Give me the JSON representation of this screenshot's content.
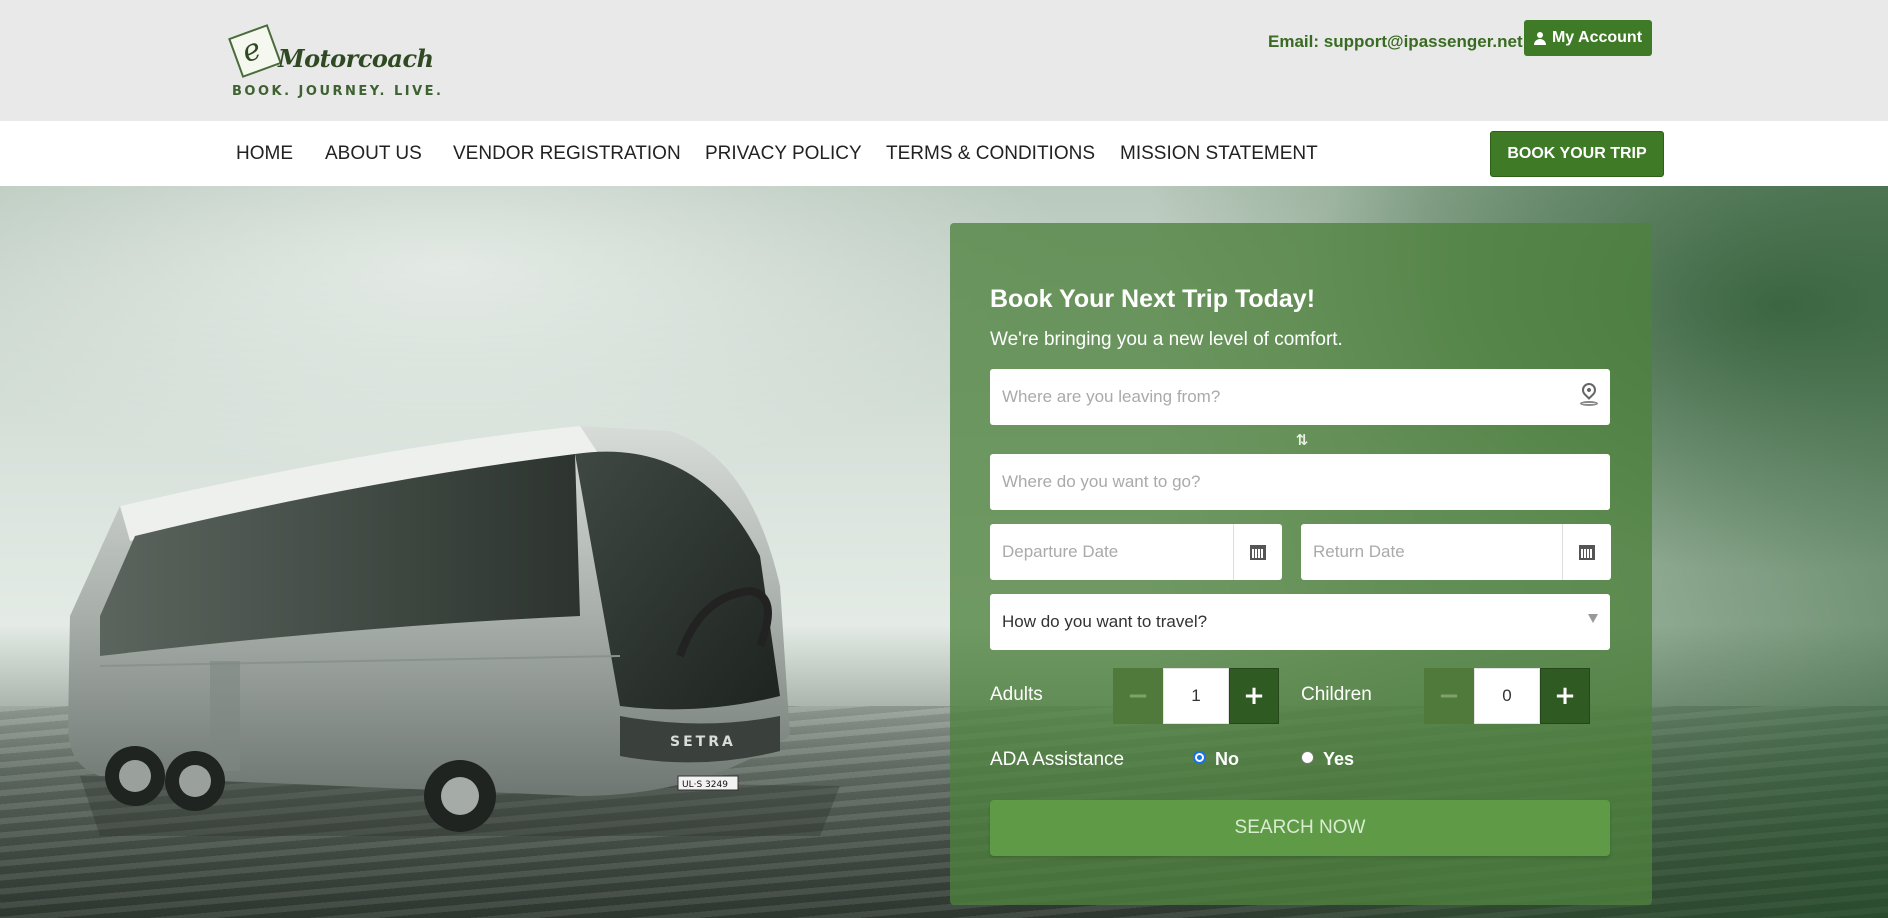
{
  "header": {
    "logo": {
      "wordmark": "Motorcoach",
      "letter": "e",
      "tagline": "BOOK. JOURNEY. LIVE."
    },
    "email_text": "Email: support@ipassenger.net",
    "account_button": "My Account"
  },
  "nav": {
    "items": [
      {
        "label": "HOME"
      },
      {
        "label": "ABOUT US"
      },
      {
        "label": "VENDOR REGISTRATION"
      },
      {
        "label": "PRIVACY POLICY"
      },
      {
        "label": "TERMS & CONDITIONS"
      },
      {
        "label": "MISSION STATEMENT"
      }
    ],
    "cta": "BOOK YOUR TRIP"
  },
  "hero": {
    "bus_plate": "UL·S 3249",
    "bus_brand": "SETRA"
  },
  "booking": {
    "title": "Book Your Next Trip Today!",
    "subtitle": "We're bringing you a new level of comfort.",
    "from_placeholder": "Where are you leaving from?",
    "to_placeholder": "Where do you want to go?",
    "departure_placeholder": "Departure Date",
    "return_placeholder": "Return Date",
    "travel_mode": "How do you want to travel?",
    "adults_label": "Adults",
    "adults_value": "1",
    "children_label": "Children",
    "children_value": "0",
    "minus_symbol": "−",
    "plus_symbol": "+",
    "ada_label": "ADA Assistance",
    "ada_options": [
      {
        "label": "No",
        "checked": true
      },
      {
        "label": "Yes",
        "checked": false
      }
    ],
    "search_button": "SEARCH NOW"
  },
  "colors": {
    "brand_green": "#3f7a26",
    "panel_green": "#4e823e",
    "header_bg": "#e9e9e9",
    "email_text": "#3a6b22"
  },
  "icons": [
    "user-icon",
    "location-pin-icon",
    "swap-icon",
    "calendar-icon",
    "chevron-down-icon"
  ]
}
